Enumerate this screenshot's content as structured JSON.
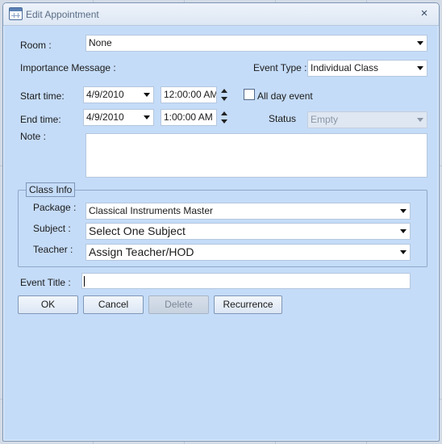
{
  "window": {
    "title": "Edit Appointment",
    "close_label": "×"
  },
  "room": {
    "label": "Room :",
    "value": "None"
  },
  "importance": {
    "label": "Importance Message :"
  },
  "event_type": {
    "label": "Event Type :",
    "value": "Individual Class"
  },
  "start": {
    "label": "Start time:",
    "date": "4/9/2010",
    "time": "12:00:00 AM"
  },
  "all_day": {
    "label": "All day event",
    "checked": false
  },
  "end": {
    "label": "End time:",
    "date": "4/9/2010",
    "time": "1:00:00 AM"
  },
  "status": {
    "label": "Status",
    "value": "Empty"
  },
  "note": {
    "label": "Note :",
    "value": ""
  },
  "class_info": {
    "legend": "Class Info",
    "package": {
      "label": "Package :",
      "value": "Classical Instruments Master"
    },
    "subject": {
      "label": "Subject :",
      "value": "Select One Subject"
    },
    "teacher": {
      "label": "Teacher :",
      "value": "Assign Teacher/HOD"
    }
  },
  "event_title": {
    "label": "Event Title :",
    "value": ""
  },
  "buttons": {
    "ok": "OK",
    "cancel": "Cancel",
    "delete": "Delete",
    "recurrence": "Recurrence"
  }
}
